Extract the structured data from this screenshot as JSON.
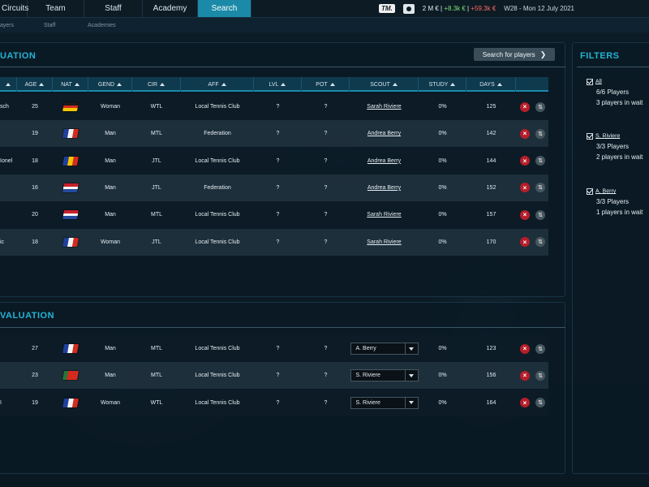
{
  "nav": {
    "tabs": [
      "Circuits",
      "Team",
      "Staff",
      "Academy",
      "Search"
    ],
    "active": "Search",
    "logo": "TM.",
    "money": "2 M €",
    "money_sep": "|",
    "income": "+8.3k €",
    "expense": "+59.3k €",
    "date": "W28 - Mon 12 July 2021",
    "icons": [
      "tm-logo",
      "money-icon"
    ]
  },
  "subnav": {
    "items": [
      "ayers",
      "Staff",
      "Academies"
    ]
  },
  "evaluation": {
    "title": "UATION",
    "search_button": "Search for players",
    "headers": [
      "AGE",
      "NAT",
      "GEND",
      "CIR",
      "AFF",
      "LVL",
      "POT",
      "SCOUT",
      "STUDY",
      "DAYS"
    ],
    "rows": [
      {
        "name": "sch",
        "age": "25",
        "nat": "de",
        "gend": "Woman",
        "cir": "WTL",
        "aff": "Local Tennis Club",
        "lvl": "?",
        "pot": "?",
        "scout": "Sarah Riviere",
        "study": "0%",
        "days": "125"
      },
      {
        "name": "",
        "age": "19",
        "nat": "fr",
        "gend": "Man",
        "cir": "MTL",
        "aff": "Federation",
        "lvl": "?",
        "pot": "?",
        "scout": "Andrea Berry",
        "study": "0%",
        "days": "142"
      },
      {
        "name": "Ionel",
        "age": "18",
        "nat": "ro",
        "gend": "Man",
        "cir": "JTL",
        "aff": "Local Tennis Club",
        "lvl": "?",
        "pot": "?",
        "scout": "Andrea Berry",
        "study": "0%",
        "days": "144"
      },
      {
        "name": "",
        "age": "16",
        "nat": "nl",
        "gend": "Man",
        "cir": "JTL",
        "aff": "Federation",
        "lvl": "?",
        "pot": "?",
        "scout": "Andrea Berry",
        "study": "0%",
        "days": "152"
      },
      {
        "name": "",
        "age": "20",
        "nat": "nl",
        "gend": "Man",
        "cir": "MTL",
        "aff": "Local Tennis Club",
        "lvl": "?",
        "pot": "?",
        "scout": "Sarah Riviere",
        "study": "0%",
        "days": "157"
      },
      {
        "name": "ic",
        "age": "18",
        "nat": "fr",
        "gend": "Woman",
        "cir": "JTL",
        "aff": "Local Tennis Club",
        "lvl": "?",
        "pot": "?",
        "scout": "Sarah Riviere",
        "study": "0%",
        "days": "170"
      }
    ]
  },
  "waiting": {
    "title": "VALUATION",
    "rows": [
      {
        "name": "",
        "age": "27",
        "nat": "fr",
        "gend": "Man",
        "cir": "MTL",
        "aff": "Local Tennis Club",
        "lvl": "?",
        "pot": "?",
        "scout": "A. Berry",
        "study": "0%",
        "days": "123"
      },
      {
        "name": "",
        "age": "23",
        "nat": "pt",
        "gend": "Man",
        "cir": "MTL",
        "aff": "Local Tennis Club",
        "lvl": "?",
        "pot": "?",
        "scout": "S. Riviere",
        "study": "0%",
        "days": "156"
      },
      {
        "name": "I",
        "age": "19",
        "nat": "fr",
        "gend": "Woman",
        "cir": "WTL",
        "aff": "Local Tennis Club",
        "lvl": "?",
        "pot": "?",
        "scout": "S. Riviere",
        "study": "0%",
        "days": "164"
      }
    ]
  },
  "filters": {
    "title": "FILTERS",
    "groups": [
      {
        "label": "All",
        "line1": "6/6 Players",
        "line2": "3 players in wait"
      },
      {
        "label": "S. Riviere",
        "line1": "3/3 Players",
        "line2": "2 players in wait"
      },
      {
        "label": "A. Berry",
        "line1": "3/3 Players",
        "line2": "1 players in wait"
      }
    ]
  },
  "colors": {
    "accent": "#1a8aa8",
    "title": "#22b4d4",
    "remove": "#b61e2a",
    "income": "#7fe07a",
    "expense": "#ff6a6a"
  },
  "flags": {
    "de": {
      "dir": "h",
      "colors": [
        "#1a1a1a",
        "#d52b1e",
        "#f3c500"
      ]
    },
    "fr": {
      "dir": "v",
      "colors": [
        "#1f3f9c",
        "#f4f4f4",
        "#d52b1e"
      ]
    },
    "ro": {
      "dir": "v",
      "colors": [
        "#1f3f9c",
        "#f3c500",
        "#d52b1e"
      ]
    },
    "nl": {
      "dir": "h",
      "colors": [
        "#c8202c",
        "#f4f4f4",
        "#234a9c"
      ]
    },
    "pt": {
      "dir": "v",
      "colors": [
        "#1f7a3a",
        "#d52b1e"
      ]
    }
  }
}
